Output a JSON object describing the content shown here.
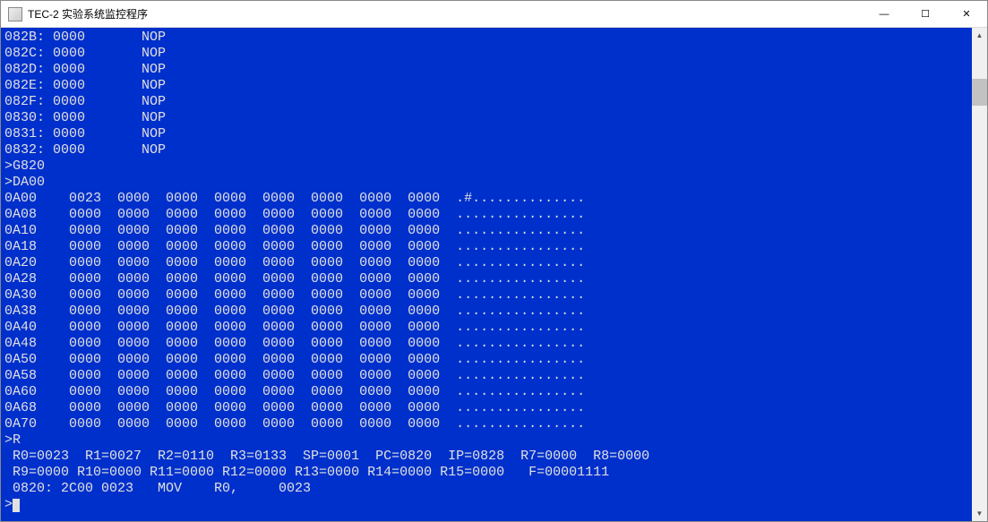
{
  "window": {
    "title": "TEC-2 实验系统监控程序",
    "controls": {
      "minimize": "—",
      "maximize": "☐",
      "close": "✕"
    }
  },
  "disassembly": [
    {
      "addr": "082B",
      "opcode": "0000",
      "mnemonic": "NOP"
    },
    {
      "addr": "082C",
      "opcode": "0000",
      "mnemonic": "NOP"
    },
    {
      "addr": "082D",
      "opcode": "0000",
      "mnemonic": "NOP"
    },
    {
      "addr": "082E",
      "opcode": "0000",
      "mnemonic": "NOP"
    },
    {
      "addr": "082F",
      "opcode": "0000",
      "mnemonic": "NOP"
    },
    {
      "addr": "0830",
      "opcode": "0000",
      "mnemonic": "NOP"
    },
    {
      "addr": "0831",
      "opcode": "0000",
      "mnemonic": "NOP"
    },
    {
      "addr": "0832",
      "opcode": "0000",
      "mnemonic": "NOP"
    }
  ],
  "commands": [
    ">G820",
    ">DA00"
  ],
  "memdump": [
    {
      "addr": "0A00",
      "words": [
        "0023",
        "0000",
        "0000",
        "0000",
        "0000",
        "0000",
        "0000",
        "0000"
      ],
      "ascii": ".#.............."
    },
    {
      "addr": "0A08",
      "words": [
        "0000",
        "0000",
        "0000",
        "0000",
        "0000",
        "0000",
        "0000",
        "0000"
      ],
      "ascii": "................"
    },
    {
      "addr": "0A10",
      "words": [
        "0000",
        "0000",
        "0000",
        "0000",
        "0000",
        "0000",
        "0000",
        "0000"
      ],
      "ascii": "................"
    },
    {
      "addr": "0A18",
      "words": [
        "0000",
        "0000",
        "0000",
        "0000",
        "0000",
        "0000",
        "0000",
        "0000"
      ],
      "ascii": "................"
    },
    {
      "addr": "0A20",
      "words": [
        "0000",
        "0000",
        "0000",
        "0000",
        "0000",
        "0000",
        "0000",
        "0000"
      ],
      "ascii": "................"
    },
    {
      "addr": "0A28",
      "words": [
        "0000",
        "0000",
        "0000",
        "0000",
        "0000",
        "0000",
        "0000",
        "0000"
      ],
      "ascii": "................"
    },
    {
      "addr": "0A30",
      "words": [
        "0000",
        "0000",
        "0000",
        "0000",
        "0000",
        "0000",
        "0000",
        "0000"
      ],
      "ascii": "................"
    },
    {
      "addr": "0A38",
      "words": [
        "0000",
        "0000",
        "0000",
        "0000",
        "0000",
        "0000",
        "0000",
        "0000"
      ],
      "ascii": "................"
    },
    {
      "addr": "0A40",
      "words": [
        "0000",
        "0000",
        "0000",
        "0000",
        "0000",
        "0000",
        "0000",
        "0000"
      ],
      "ascii": "................"
    },
    {
      "addr": "0A48",
      "words": [
        "0000",
        "0000",
        "0000",
        "0000",
        "0000",
        "0000",
        "0000",
        "0000"
      ],
      "ascii": "................"
    },
    {
      "addr": "0A50",
      "words": [
        "0000",
        "0000",
        "0000",
        "0000",
        "0000",
        "0000",
        "0000",
        "0000"
      ],
      "ascii": "................"
    },
    {
      "addr": "0A58",
      "words": [
        "0000",
        "0000",
        "0000",
        "0000",
        "0000",
        "0000",
        "0000",
        "0000"
      ],
      "ascii": "................"
    },
    {
      "addr": "0A60",
      "words": [
        "0000",
        "0000",
        "0000",
        "0000",
        "0000",
        "0000",
        "0000",
        "0000"
      ],
      "ascii": "................"
    },
    {
      "addr": "0A68",
      "words": [
        "0000",
        "0000",
        "0000",
        "0000",
        "0000",
        "0000",
        "0000",
        "0000"
      ],
      "ascii": "................"
    },
    {
      "addr": "0A70",
      "words": [
        "0000",
        "0000",
        "0000",
        "0000",
        "0000",
        "0000",
        "0000",
        "0000"
      ],
      "ascii": "................"
    }
  ],
  "reg_cmd": ">R",
  "registers_line1": " R0=0023  R1=0027  R2=0110  R3=0133  SP=0001  PC=0820  IP=0828  R7=0000  R8=0000",
  "registers_line2": " R9=0000 R10=0000 R11=0000 R12=0000 R13=0000 R14=0000 R15=0000   F=00001111",
  "current_instr": " 0820: 2C00 0023   MOV    R0,     0023",
  "prompt": ">"
}
